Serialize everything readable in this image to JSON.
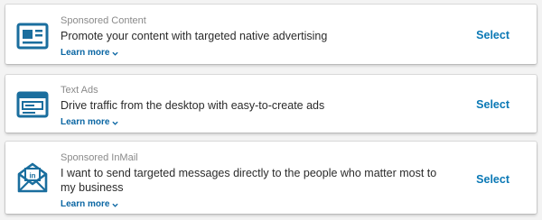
{
  "colors": {
    "accent": "#0a78b5",
    "icon": "#1a6e9e",
    "label": "#8a8a8a",
    "text": "#2b2b2b"
  },
  "options": [
    {
      "label": "Sponsored Content",
      "description": "Promote your content with targeted native advertising",
      "learn_more": "Learn more",
      "select": "Select",
      "icon": "newspaper-icon"
    },
    {
      "label": "Text Ads",
      "description": "Drive traffic from the desktop with easy-to-create ads",
      "learn_more": "Learn more",
      "select": "Select",
      "icon": "browser-window-icon"
    },
    {
      "label": "Sponsored InMail",
      "description": "I want to send targeted messages directly to the people who matter most to my business",
      "learn_more": "Learn more",
      "select": "Select",
      "icon": "linkedin-envelope-icon"
    }
  ]
}
